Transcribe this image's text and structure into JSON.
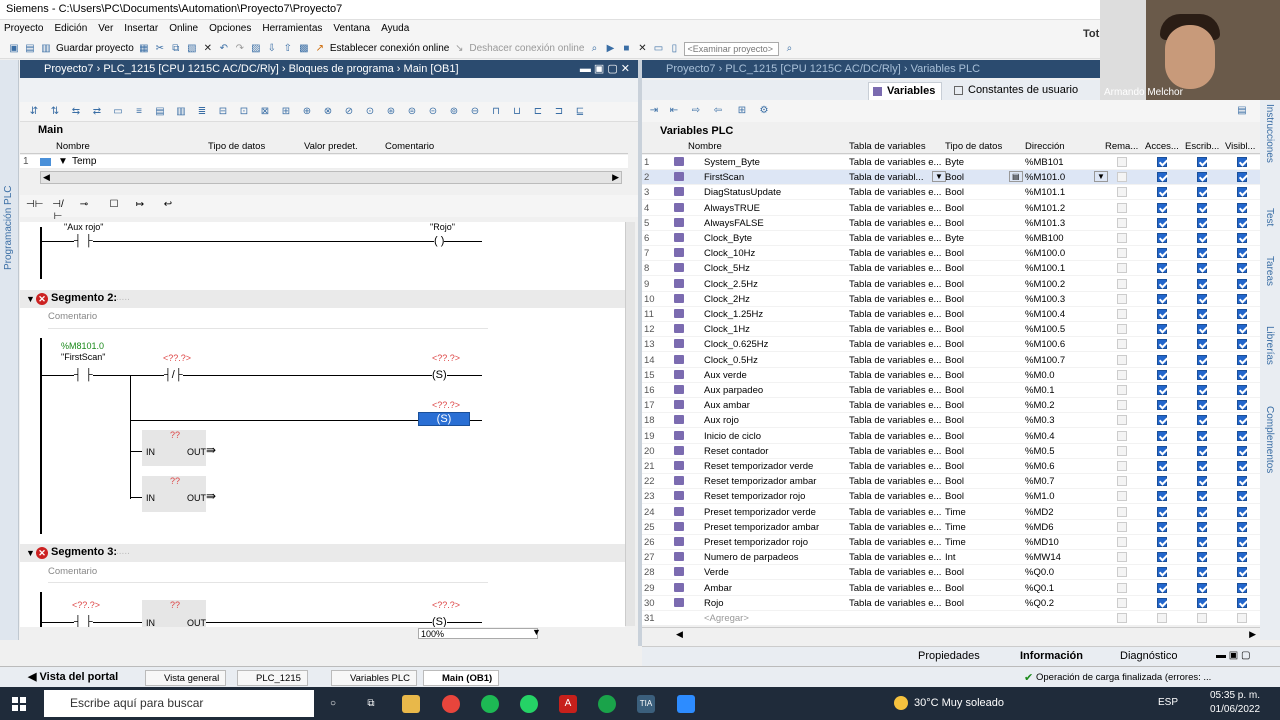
{
  "window": {
    "title": "Siemens  -  C:\\Users\\PC\\Documents\\Automation\\Proyecto7\\Proyecto7",
    "user_partial": "Tot"
  },
  "menu": [
    "Proyecto",
    "Edición",
    "Ver",
    "Insertar",
    "Online",
    "Opciones",
    "Herramientas",
    "Ventana",
    "Ayuda"
  ],
  "toolbar": {
    "save": "Guardar proyecto",
    "connect": "Establecer conexión online",
    "disconnect": "Deshacer conexión online",
    "search_placeholder": "<Examinar proyecto>"
  },
  "webcam": {
    "name": "Armando Melchor"
  },
  "left": {
    "breadcrumb": [
      "Proyecto7",
      "PLC_1215 [CPU 1215C AC/DC/Rly]",
      "Bloques de programa",
      "Main [OB1]"
    ],
    "side_label": "Programación PLC",
    "block": "Main",
    "iface_cols": [
      "Nombre",
      "Tipo de datos",
      "Valor predet.",
      "Comentario"
    ],
    "iface_row": {
      "num": "1",
      "name": "Temp"
    },
    "zoom": "100%",
    "net1": {
      "contact": "\"Aux rojo\"",
      "coil": "\"Rojo\""
    },
    "net2": {
      "title": "Segmento 2:",
      "comment": "Comentario",
      "addr": "%M8101.0",
      "var": "\"FirstScan\"",
      "unk": "<??.?>",
      "set": "S",
      "box_q": "??",
      "in": "IN",
      "out": "OUT"
    },
    "net3": {
      "title": "Segmento 3:",
      "comment": "Comentario",
      "unk": "<??.?>",
      "box_q": "??",
      "in": "IN",
      "out": "OUT",
      "set": "S"
    }
  },
  "right": {
    "breadcrumb": [
      "Proyecto7",
      "PLC_1215 [CPU 1215C AC/DC/Rly]",
      "Variables PLC"
    ],
    "tabs": [
      "Variables",
      "Constantes de usuario"
    ],
    "title": "Variables PLC",
    "columns": [
      "Nombre",
      "Tabla de variables",
      "Tipo de datos",
      "Dirección",
      "Rema...",
      "Acces...",
      "Escrib...",
      "Visibl..."
    ],
    "rows": [
      {
        "n": "1",
        "name": "System_Byte",
        "table": "Tabla de variables e...",
        "type": "Byte",
        "addr": "%MB101"
      },
      {
        "n": "2",
        "name": "FirstScan",
        "table": "Tabla de variabl...",
        "type": "Bool",
        "addr": "%M101.0"
      },
      {
        "n": "3",
        "name": "DiagStatusUpdate",
        "table": "Tabla de variables e...",
        "type": "Bool",
        "addr": "%M101.1"
      },
      {
        "n": "4",
        "name": "AlwaysTRUE",
        "table": "Tabla de variables e...",
        "type": "Bool",
        "addr": "%M101.2"
      },
      {
        "n": "5",
        "name": "AlwaysFALSE",
        "table": "Tabla de variables e...",
        "type": "Bool",
        "addr": "%M101.3"
      },
      {
        "n": "6",
        "name": "Clock_Byte",
        "table": "Tabla de variables e...",
        "type": "Byte",
        "addr": "%MB100"
      },
      {
        "n": "7",
        "name": "Clock_10Hz",
        "table": "Tabla de variables e...",
        "type": "Bool",
        "addr": "%M100.0"
      },
      {
        "n": "8",
        "name": "Clock_5Hz",
        "table": "Tabla de variables e...",
        "type": "Bool",
        "addr": "%M100.1"
      },
      {
        "n": "9",
        "name": "Clock_2.5Hz",
        "table": "Tabla de variables e...",
        "type": "Bool",
        "addr": "%M100.2"
      },
      {
        "n": "10",
        "name": "Clock_2Hz",
        "table": "Tabla de variables e...",
        "type": "Bool",
        "addr": "%M100.3"
      },
      {
        "n": "11",
        "name": "Clock_1.25Hz",
        "table": "Tabla de variables e...",
        "type": "Bool",
        "addr": "%M100.4"
      },
      {
        "n": "12",
        "name": "Clock_1Hz",
        "table": "Tabla de variables e...",
        "type": "Bool",
        "addr": "%M100.5"
      },
      {
        "n": "13",
        "name": "Clock_0.625Hz",
        "table": "Tabla de variables e...",
        "type": "Bool",
        "addr": "%M100.6"
      },
      {
        "n": "14",
        "name": "Clock_0.5Hz",
        "table": "Tabla de variables e...",
        "type": "Bool",
        "addr": "%M100.7"
      },
      {
        "n": "15",
        "name": "Aux verde",
        "table": "Tabla de variables e...",
        "type": "Bool",
        "addr": "%M0.0"
      },
      {
        "n": "16",
        "name": "Aux parpadeo",
        "table": "Tabla de variables e...",
        "type": "Bool",
        "addr": "%M0.1"
      },
      {
        "n": "17",
        "name": "Aux ambar",
        "table": "Tabla de variables e...",
        "type": "Bool",
        "addr": "%M0.2"
      },
      {
        "n": "18",
        "name": "Aux rojo",
        "table": "Tabla de variables e...",
        "type": "Bool",
        "addr": "%M0.3"
      },
      {
        "n": "19",
        "name": "Inicio de ciclo",
        "table": "Tabla de variables e...",
        "type": "Bool",
        "addr": "%M0.4"
      },
      {
        "n": "20",
        "name": "Reset contador",
        "table": "Tabla de variables e...",
        "type": "Bool",
        "addr": "%M0.5"
      },
      {
        "n": "21",
        "name": "Reset temporizador verde",
        "table": "Tabla de variables e...",
        "type": "Bool",
        "addr": "%M0.6"
      },
      {
        "n": "22",
        "name": "Reset temporizador ambar",
        "table": "Tabla de variables e...",
        "type": "Bool",
        "addr": "%M0.7"
      },
      {
        "n": "23",
        "name": "Reset temporizador rojo",
        "table": "Tabla de variables e...",
        "type": "Bool",
        "addr": "%M1.0"
      },
      {
        "n": "24",
        "name": "Preset temporizador verde",
        "table": "Tabla de variables e...",
        "type": "Time",
        "addr": "%MD2"
      },
      {
        "n": "25",
        "name": "Preset temporizador ambar",
        "table": "Tabla de variables e...",
        "type": "Time",
        "addr": "%MD6"
      },
      {
        "n": "26",
        "name": "Preset temporizador rojo",
        "table": "Tabla de variables e...",
        "type": "Time",
        "addr": "%MD10"
      },
      {
        "n": "27",
        "name": "Numero de parpadeos",
        "table": "Tabla de variables e...",
        "type": "Int",
        "addr": "%MW14"
      },
      {
        "n": "28",
        "name": "Verde",
        "table": "Tabla de variables e...",
        "type": "Bool",
        "addr": "%Q0.0"
      },
      {
        "n": "29",
        "name": "Ambar",
        "table": "Tabla de variables e...",
        "type": "Bool",
        "addr": "%Q0.1"
      },
      {
        "n": "30",
        "name": "Rojo",
        "table": "Tabla de variables e...",
        "type": "Bool",
        "addr": "%Q0.2"
      },
      {
        "n": "31",
        "name": "<Agregar>",
        "table": "",
        "type": "",
        "addr": ""
      }
    ],
    "side_tabs": [
      "Instrucciones",
      "Test",
      "Tareas",
      "Librerías",
      "Complementos"
    ]
  },
  "status": {
    "props": "Propiedades",
    "info": "Información",
    "diag": "Diagnóstico",
    "message": "Operación de carga finalizada (errores: ..."
  },
  "portal": {
    "view": "Vista del portal",
    "tabs": [
      "Vista general",
      "PLC_1215",
      "Variables PLC",
      "Main (OB1)"
    ]
  },
  "taskbar": {
    "search": "Escribe aquí para buscar",
    "temp": "30°C  Muy soleado",
    "lang": "ESP",
    "time": "05:35 p. m.",
    "date": "01/06/2022"
  }
}
